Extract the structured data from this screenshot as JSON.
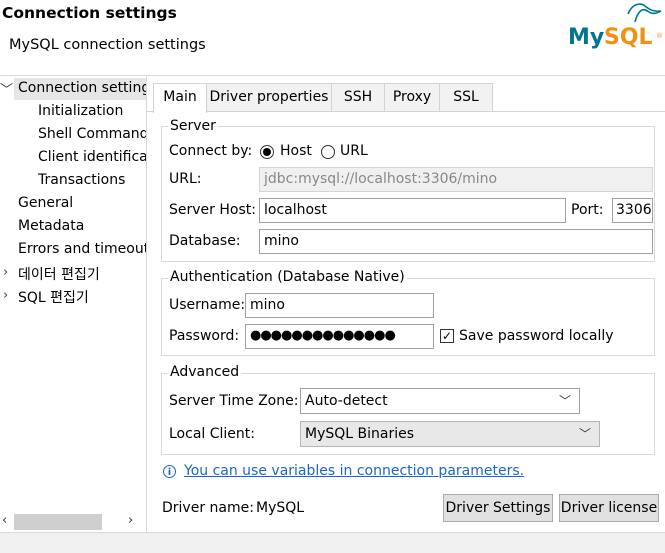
{
  "header": {
    "title": "Connection settings",
    "subtitle": "MySQL connection settings",
    "logo_text": "MySQL"
  },
  "nav": {
    "items": [
      {
        "label": "Connection settings",
        "expanded": true,
        "selected": true
      },
      {
        "label": "Initialization"
      },
      {
        "label": "Shell Commands"
      },
      {
        "label": "Client identification"
      },
      {
        "label": "Transactions"
      },
      {
        "label": "General"
      },
      {
        "label": "Metadata"
      },
      {
        "label": "Errors and timeouts"
      },
      {
        "label": "데이터 편집기",
        "expandable": true
      },
      {
        "label": "SQL 편집기",
        "expandable": true
      }
    ]
  },
  "tabs": [
    "Main",
    "Driver properties",
    "SSH",
    "Proxy",
    "SSL"
  ],
  "active_tab": "Main",
  "server": {
    "group_label": "Server",
    "connect_by_label": "Connect by:",
    "host_option": "Host",
    "url_option": "URL",
    "selected": "Host",
    "url_label": "URL:",
    "url_value": "jdbc:mysql://localhost:3306/mino",
    "host_label": "Server Host:",
    "host_value": "localhost",
    "port_label": "Port:",
    "port_value": "3306",
    "database_label": "Database:",
    "database_value": "mino"
  },
  "auth": {
    "group_label": "Authentication (Database Native)",
    "username_label": "Username:",
    "username_value": "mino",
    "password_label": "Password:",
    "password_value": "●●●●●●●●●●●●●●",
    "save_password_label": "Save password locally",
    "save_password_checked": true
  },
  "advanced": {
    "group_label": "Advanced",
    "timezone_label": "Server Time Zone:",
    "timezone_value": "Auto-detect",
    "client_label": "Local Client:",
    "client_value": "MySQL Binaries"
  },
  "info": {
    "link_text": "You can use variables in connection parameters."
  },
  "footer": {
    "driver_name_label": "Driver name:",
    "driver_name_value": "MySQL",
    "driver_settings_button": "Driver Settings",
    "driver_license_button": "Driver license"
  },
  "colors": {
    "accent_link": "#1a66c9",
    "logo_blue": "#00758f",
    "logo_orange": "#f29111"
  }
}
